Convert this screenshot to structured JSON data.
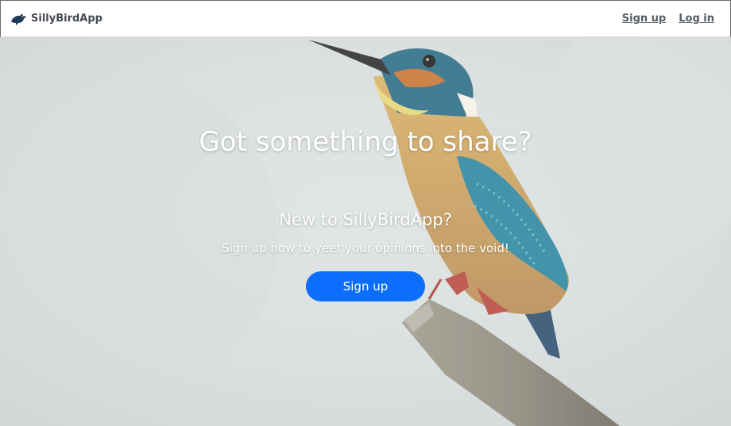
{
  "navbar": {
    "brand": "SillyBirdApp",
    "brand_icon": "bird-icon",
    "links": {
      "signup": "Sign up",
      "login": "Log in"
    }
  },
  "hero": {
    "background_image": "kingfisher perched on branch",
    "title": "Got something to share?",
    "subtitle": "New to SillyBirdApp?",
    "text": "Sign up now to yeet your opinions into the void!",
    "cta": "Sign up"
  },
  "colors": {
    "primary": "#0d6efd",
    "navbar_bg": "#ffffff",
    "hero_text": "#ffffff"
  }
}
